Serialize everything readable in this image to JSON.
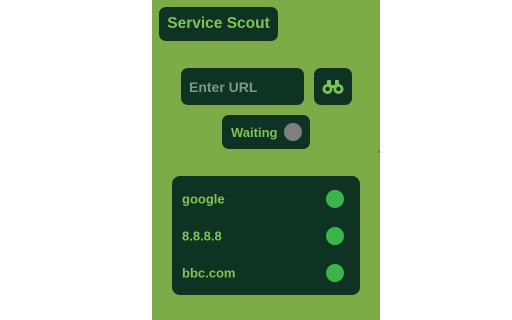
{
  "app": {
    "title": "Service Scout"
  },
  "search": {
    "placeholder": "Enter URL",
    "value": "",
    "button_icon": "binoculars-icon"
  },
  "status": {
    "label": "Waiting",
    "indicator_color": "#7f7f7f"
  },
  "services": [
    {
      "name": "google",
      "status_color": "#3bb54a"
    },
    {
      "name": "8.8.8.8",
      "status_color": "#3bb54a"
    },
    {
      "name": "bbc.com",
      "status_color": "#3bb54a"
    }
  ],
  "colors": {
    "panel_background": "#7dab47",
    "box_background": "#0f3322",
    "accent_text": "#7fc257"
  }
}
